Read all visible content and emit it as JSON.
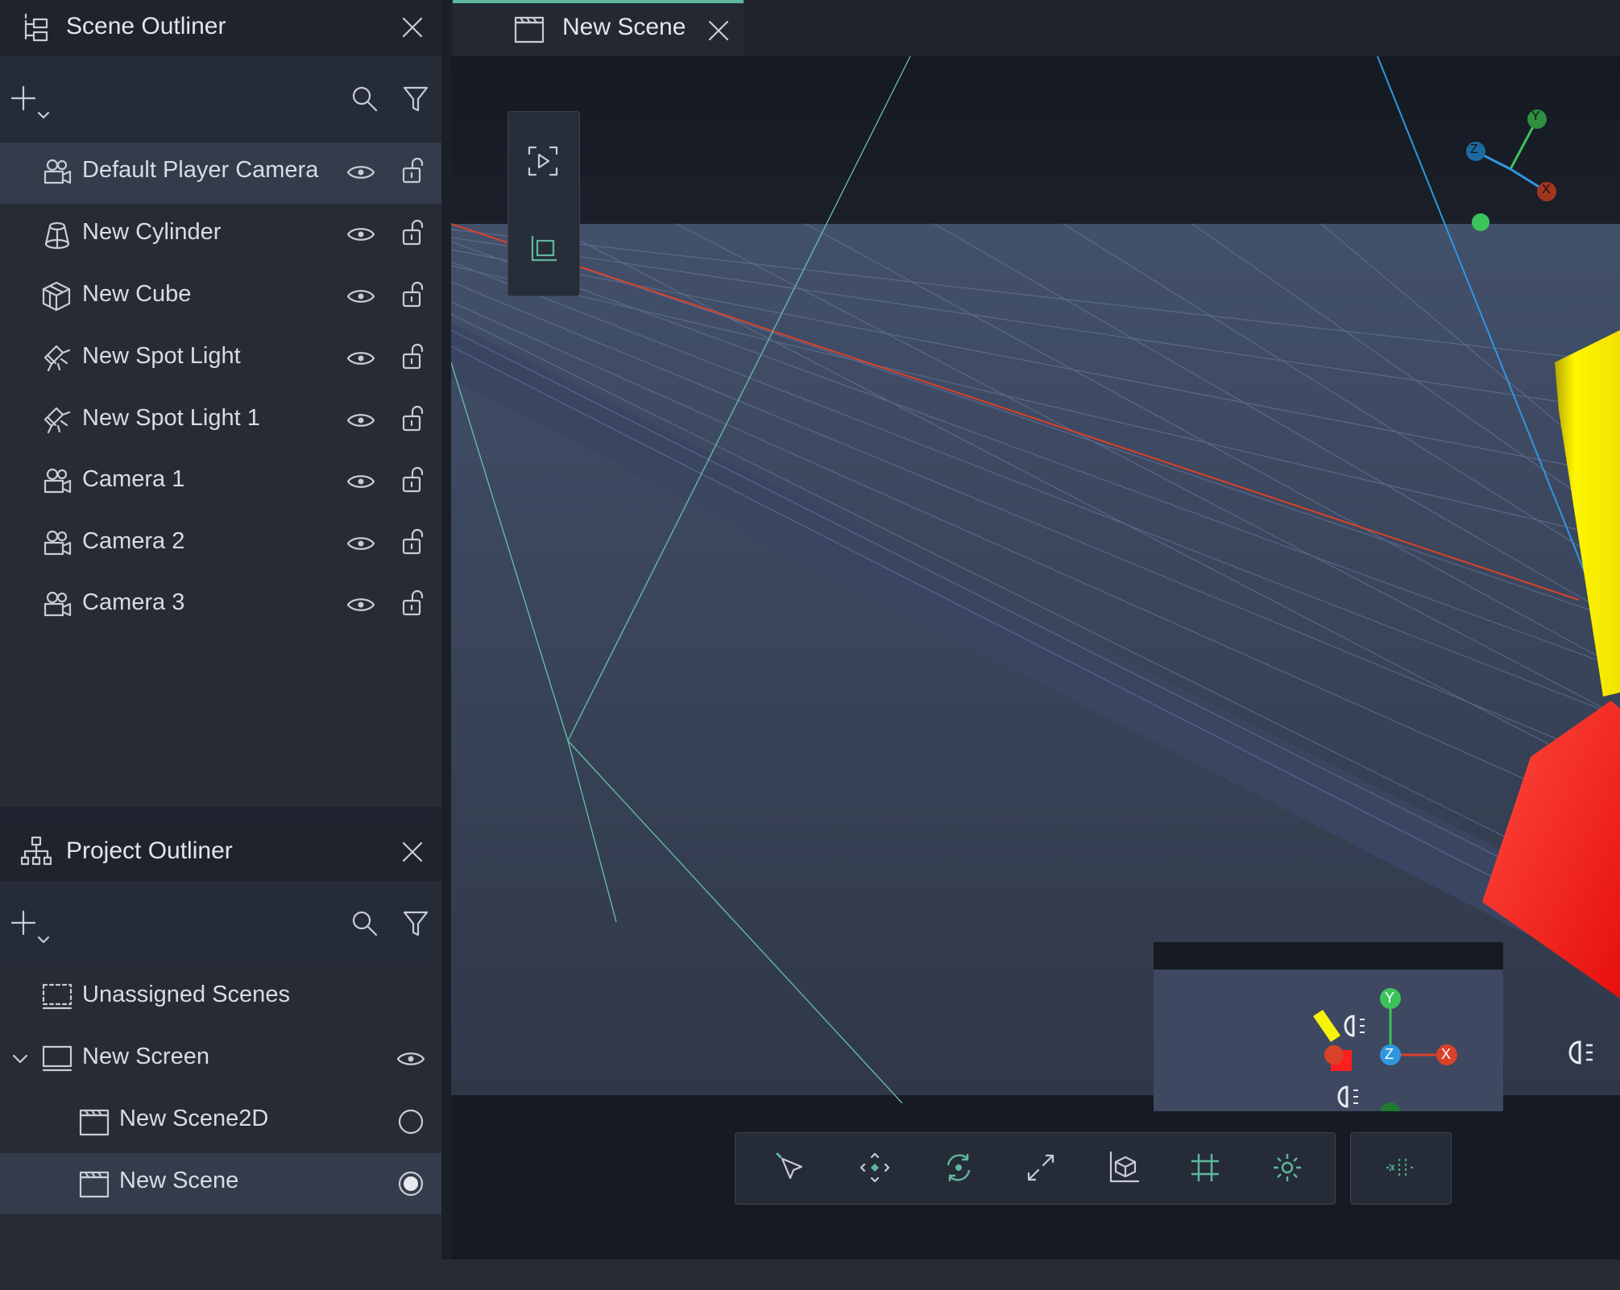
{
  "scene_outliner": {
    "title": "Scene Outliner",
    "items": [
      {
        "label": "Default Player Camera",
        "icon": "camera-icon",
        "selected": true
      },
      {
        "label": "New Cylinder",
        "icon": "cylinder-icon",
        "selected": false
      },
      {
        "label": "New Cube",
        "icon": "cube-icon",
        "selected": false
      },
      {
        "label": "New Spot Light",
        "icon": "spotlight-icon",
        "selected": false
      },
      {
        "label": "New Spot Light 1",
        "icon": "spotlight-icon",
        "selected": false
      },
      {
        "label": "Camera 1",
        "icon": "camera-icon",
        "selected": false
      },
      {
        "label": "Camera 2",
        "icon": "camera-icon",
        "selected": false
      },
      {
        "label": "Camera 3",
        "icon": "camera-icon",
        "selected": false
      }
    ]
  },
  "project_outliner": {
    "title": "Project Outliner",
    "items": [
      {
        "label": "Unassigned Scenes",
        "icon": "unassigned-scenes-icon"
      },
      {
        "label": "New Screen",
        "icon": "screen-icon"
      },
      {
        "label": "New Scene2D",
        "icon": "scene-icon"
      },
      {
        "label": "New Scene",
        "icon": "scene-icon",
        "selected": true
      }
    ]
  },
  "tabs": [
    {
      "label": "New Scene",
      "active": true
    }
  ],
  "gizmo_labels": {
    "x": "X",
    "y": "Y",
    "z": "Z"
  },
  "colors": {
    "accent": "#5fb79e",
    "axis_x": "#d9412b",
    "axis_y": "#3cc45a",
    "axis_z": "#2f97e0",
    "cube": "#ff1e1e",
    "cylinder": "#f6f20c"
  }
}
